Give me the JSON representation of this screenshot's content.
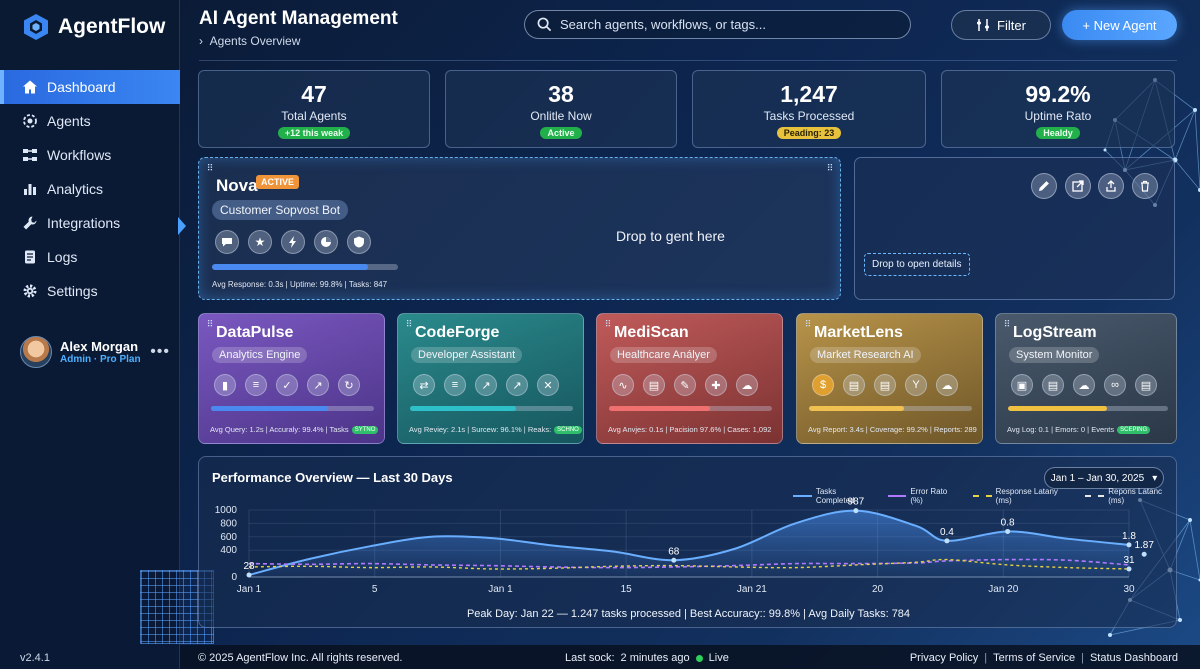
{
  "app": {
    "name": "AgentFlow",
    "version": "v2.4.1"
  },
  "sidebar": {
    "items": [
      {
        "label": "Dashboard",
        "icon": "home-icon"
      },
      {
        "label": "Agents",
        "icon": "agents-icon"
      },
      {
        "label": "Workflows",
        "icon": "workflow-icon"
      },
      {
        "label": "Analytics",
        "icon": "bar-chart-icon"
      },
      {
        "label": "Integrations",
        "icon": "wrench-icon"
      },
      {
        "label": "Logs",
        "icon": "log-icon"
      },
      {
        "label": "Settings",
        "icon": "gear-icon"
      }
    ],
    "user": {
      "name": "Alex Morgan",
      "role": "Admin · Pro Plan"
    }
  },
  "header": {
    "title": "AI Agent Management",
    "breadcrumb": "Agents Overview",
    "search_placeholder": "Search agents, workflows, or tags...",
    "filter_label": "Filter",
    "new_agent_label": "+ New Agent"
  },
  "stats": [
    {
      "value": "47",
      "label": "Total Agents",
      "badge": "+12 this weak",
      "badge_color": "green"
    },
    {
      "value": "38",
      "label": "Onlitle Now",
      "badge": "Active",
      "badge_color": "green"
    },
    {
      "value": "1,247",
      "label": "Tasks Processed",
      "badge": "Peading: 23",
      "badge_color": "yellow"
    },
    {
      "value": "99.2%",
      "label": "Uptime Rato",
      "badge": "Healdy",
      "badge_color": "green"
    }
  ],
  "featured_agent": {
    "name": "Nova",
    "status": "ACTIVE",
    "role": "Customer Sopvost Bot",
    "progress": 0.84,
    "stats": "Avg Response: 0.3s  |  Uptime: 99.8%  |  Tasks: 847",
    "drop_text": "Drop to gent here",
    "icons": [
      "chat-icon",
      "star-icon",
      "bolt-icon",
      "pie-icon",
      "shield-icon"
    ]
  },
  "detail_panel": {
    "drop_text": "Drop to open details",
    "actions": [
      "edit-icon",
      "external-icon",
      "share-icon",
      "trash-icon"
    ]
  },
  "agents": [
    {
      "name": "DataPulse",
      "role": "Analytics Engine",
      "color": "#6a4aa8",
      "bar": "#4a8af0",
      "progress": 0.72,
      "stats": "Avg Query: 1.2s  |  Accuraly: 99.4%  |  Tasks",
      "badge": "SYTNO"
    },
    {
      "name": "CodeForge",
      "role": "Developer Assistant",
      "color": "#1f7a7e",
      "bar": "#2ec0c8",
      "progress": 0.65,
      "stats": "Avg Reviey: 2.1s  |  Surcew: 96.1%  |  Reaks:",
      "badge": "SCHNO"
    },
    {
      "name": "MediScan",
      "role": "Healthcare Anályer",
      "color": "#a84444",
      "bar": "#f07070",
      "progress": 0.62,
      "stats": "Avg Anvjes: 0.1s  |  Pacision 97.6%  |  Cases: 1,092",
      "badge": ""
    },
    {
      "name": "MarketLens",
      "role": "Market Research AI",
      "color": "#9a7a3a",
      "bar": "#f0c050",
      "progress": 0.58,
      "stats": "Avg Report: 3.4s  |  Coverage: 99.2%  |  Reports: 289",
      "badge": ""
    },
    {
      "name": "LogStream",
      "role": "System Monitor",
      "color": "#3a4a5c",
      "bar": "#f0c040",
      "progress": 0.62,
      "stats": "Avg Log: 0.1   |  Emors: 0   |  Events",
      "badge": "SCEPING"
    }
  ],
  "agent_icons": [
    [
      "bar-chart-icon",
      "database-icon",
      "check-icon",
      "trend-icon",
      "refresh-icon"
    ],
    [
      "git-icon",
      "database-icon",
      "trend-icon",
      "trend-icon",
      "close-icon"
    ],
    [
      "pulse-icon",
      "doc-icon",
      "edit-icon",
      "plus-icon",
      "cloud-icon"
    ],
    [
      "dollar-icon",
      "doc-icon",
      "doc-icon",
      "branch-icon",
      "cloud-icon"
    ],
    [
      "monitor-icon",
      "doc-icon",
      "cloud-icon",
      "link-icon",
      "doc-icon"
    ]
  ],
  "performance": {
    "title": "Performance Overview — Last 30 Days",
    "date_range": "Jan 1 – Jan 30, 2025",
    "summary": "Peak Day: Jan 22 — 1.247 tasks processed   |   Best Accuracy:: 99.8%   |   Avg Daily Tasks: 784"
  },
  "chart_data": {
    "type": "area",
    "legend": [
      "Tasks Completed",
      "Error Rato (%)",
      "Response Latany (ms)",
      "Repons Latanc (ms)"
    ],
    "legend_colors": [
      "#6aaeff",
      "#b07aff",
      "#e8d040",
      "#e8e8e8"
    ],
    "x_ticks": [
      "Jan 1",
      "5",
      "Jan 1",
      "15",
      "Jan 21",
      "20",
      "Jan 20",
      "30"
    ],
    "y_ticks": [
      0,
      400,
      600,
      800,
      1000
    ],
    "ylim": [
      0,
      1000
    ],
    "x": [
      1,
      3,
      5,
      7,
      9,
      11,
      13,
      15,
      17,
      19,
      21,
      23,
      24,
      26,
      28,
      30
    ],
    "series": [
      {
        "name": "Tasks Completed",
        "values": [
          30,
          270,
          460,
          600,
          580,
          470,
          380,
          250,
          420,
          800,
          990,
          760,
          540,
          680,
          570,
          480
        ]
      },
      {
        "name": "Error Rato (%)",
        "values": [
          200,
          190,
          200,
          180,
          170,
          150,
          140,
          150,
          170,
          200,
          200,
          210,
          240,
          260,
          250,
          180
        ]
      },
      {
        "name": "Response Latany (ms)",
        "values": [
          150,
          160,
          140,
          150,
          120,
          130,
          160,
          170,
          150,
          140,
          180,
          220,
          260,
          180,
          140,
          120
        ]
      }
    ],
    "annotations": [
      {
        "label": "28",
        "x": 1,
        "y": 30
      },
      {
        "label": "68",
        "x": 15,
        "y": 250
      },
      {
        "label": "987",
        "x": 21,
        "y": 990
      },
      {
        "label": "0.4",
        "x": 24,
        "y": 540
      },
      {
        "label": "0.8",
        "x": 26,
        "y": 680
      },
      {
        "label": "1.8",
        "x": 30,
        "y": 480
      },
      {
        "label": "1.87",
        "x": 30.5,
        "y": 340
      },
      {
        "label": "31",
        "x": 30,
        "y": 120
      }
    ]
  },
  "footer": {
    "copyright": "© 2025 AgentFlow Inc. All rights reserved.",
    "sync_label": "Last sock:",
    "sync_time": "2 minutes ago",
    "sync_status": "Live",
    "links": [
      "Privacy Policy",
      "Terms of Service",
      "Status Dashboard"
    ]
  }
}
